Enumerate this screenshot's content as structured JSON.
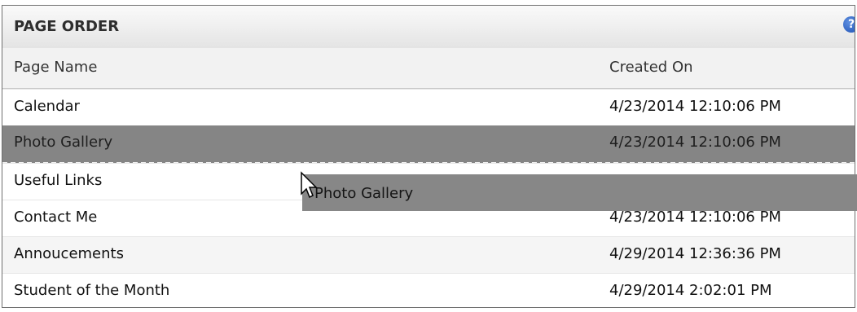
{
  "panel": {
    "title": "PAGE ORDER",
    "help_icon": "question-circle-icon",
    "columns": {
      "name": "Page Name",
      "created": "Created On"
    },
    "rows": [
      {
        "name": "Calendar",
        "created": "4/23/2014 12:10:06 PM"
      },
      {
        "name": "Photo Gallery",
        "created": "4/23/2014 12:10:06 PM"
      },
      {
        "name": "Useful Links",
        "created": ""
      },
      {
        "name": "Contact Me",
        "created": "4/23/2014 12:10:06 PM"
      },
      {
        "name": "Annoucements",
        "created": "4/29/2014 12:36:36 PM"
      },
      {
        "name": "Student of the Month",
        "created": "4/29/2014 2:02:01 PM"
      }
    ]
  },
  "drag": {
    "label": "Photo Gallery",
    "cursor_icon": "arrow-cursor-icon"
  },
  "colors": {
    "drag_row": "#858585",
    "header_bg": "#f2f2f2",
    "help": "#2a5cc4"
  }
}
